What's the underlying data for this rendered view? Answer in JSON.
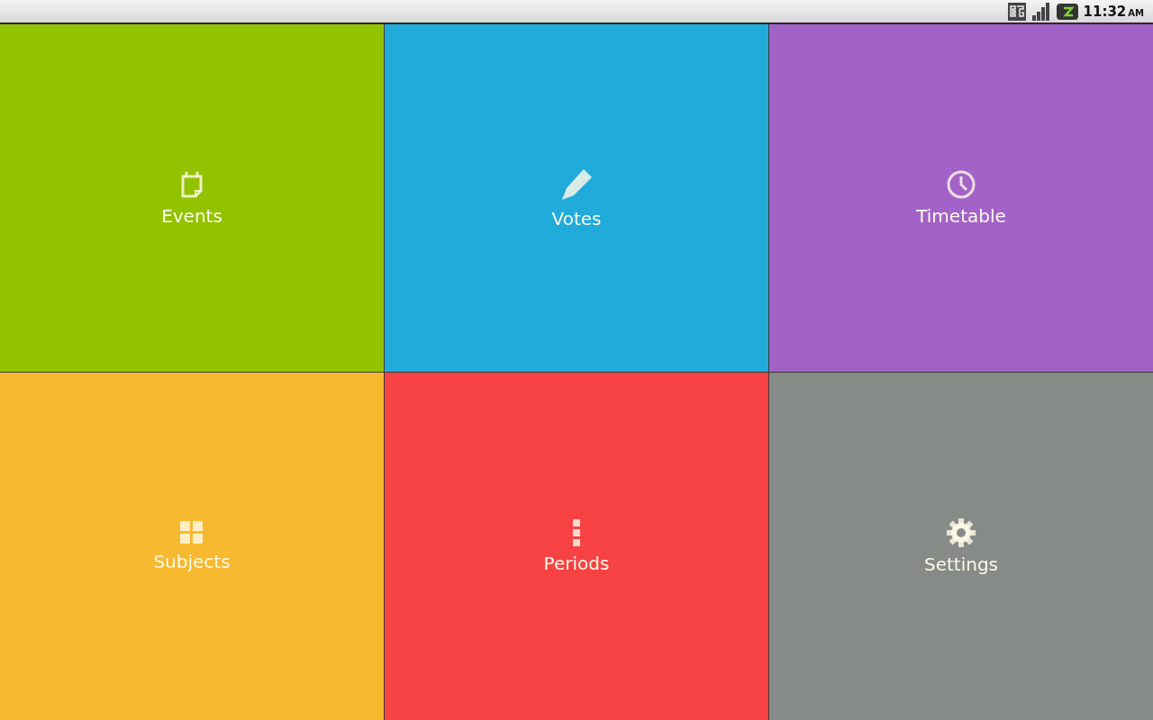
{
  "status_bar": {
    "time": "11:32",
    "period": "AM"
  },
  "tiles": [
    {
      "label": "Events",
      "kind": "calendar",
      "color": "#93c200"
    },
    {
      "label": "Votes",
      "kind": "pencil",
      "color": "#21abdb"
    },
    {
      "label": "Timetable",
      "kind": "clock",
      "color": "#a362c8"
    },
    {
      "label": "Subjects",
      "kind": "grid",
      "color": "#f7b92f"
    },
    {
      "label": "Periods",
      "kind": "dots",
      "color": "#f74244"
    },
    {
      "label": "Settings",
      "kind": "gear",
      "color": "#878b88"
    }
  ]
}
